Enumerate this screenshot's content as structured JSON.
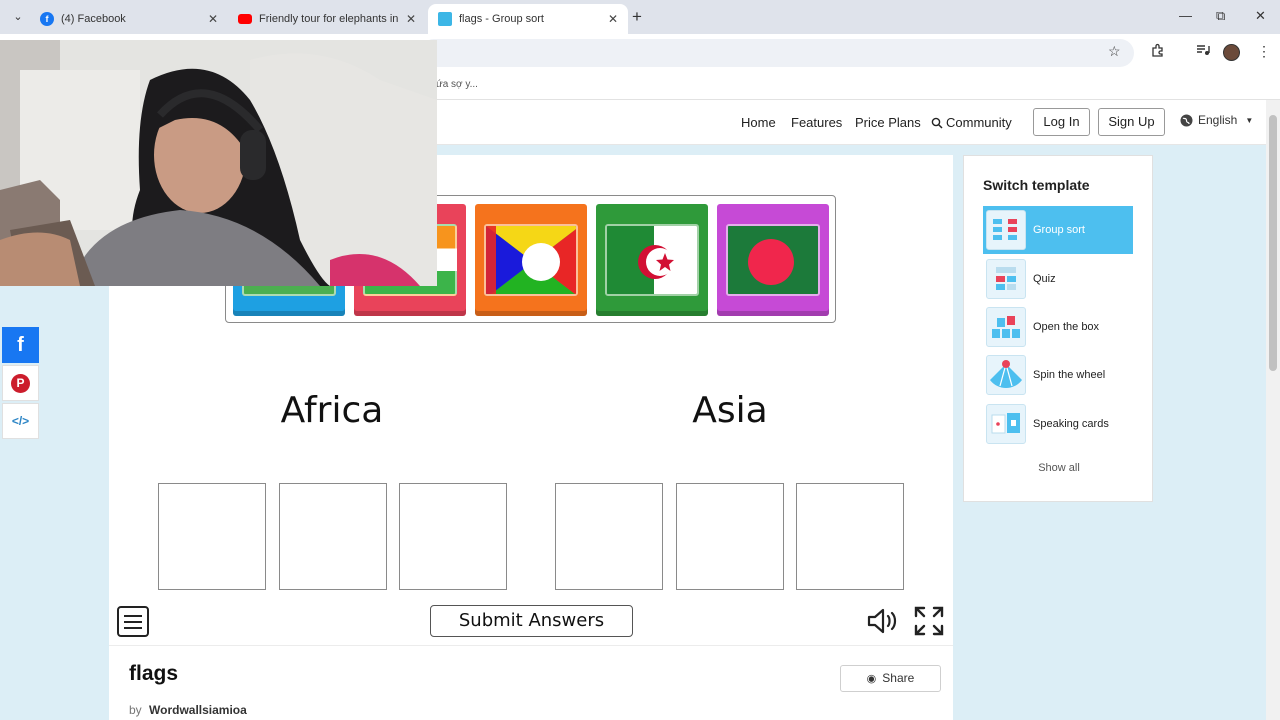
{
  "browser": {
    "tabs": [
      {
        "title": "(4) Facebook",
        "icon": "facebook-icon"
      },
      {
        "title": "Friendly tour for elephants in D",
        "icon": "youtube-icon"
      },
      {
        "title": "flags - Group sort",
        "icon": "wordwall-icon"
      }
    ],
    "bookmark_fragment": "ứa sợ y..."
  },
  "site_nav": {
    "home": "Home",
    "features": "Features",
    "price_plans": "Price Plans",
    "community": "Community",
    "login": "Log In",
    "signup": "Sign Up",
    "language": "English"
  },
  "game": {
    "groups": [
      {
        "title": "Africa"
      },
      {
        "title": "Asia"
      }
    ],
    "submit_label": "Submit Answers",
    "tiles": [
      {
        "color": "#1ea0e2"
      },
      {
        "color": "#e9435a"
      },
      {
        "color": "#f5731d"
      },
      {
        "color": "#2f9a3a"
      },
      {
        "color": "#c64ad6"
      }
    ]
  },
  "activity": {
    "title": "flags",
    "by_label": "by",
    "author": "Wordwallsiamioa",
    "share_label": "Share"
  },
  "switch_template": {
    "title": "Switch template",
    "items": [
      {
        "label": "Group sort"
      },
      {
        "label": "Quiz"
      },
      {
        "label": "Open the box"
      },
      {
        "label": "Spin the wheel"
      },
      {
        "label": "Speaking cards"
      }
    ],
    "show_all": "Show all"
  },
  "colors": {
    "accent": "#4dbfef",
    "page_bg": "#dceef6",
    "facebook": "#1877f2",
    "pinterest": "#cc1d2c"
  }
}
